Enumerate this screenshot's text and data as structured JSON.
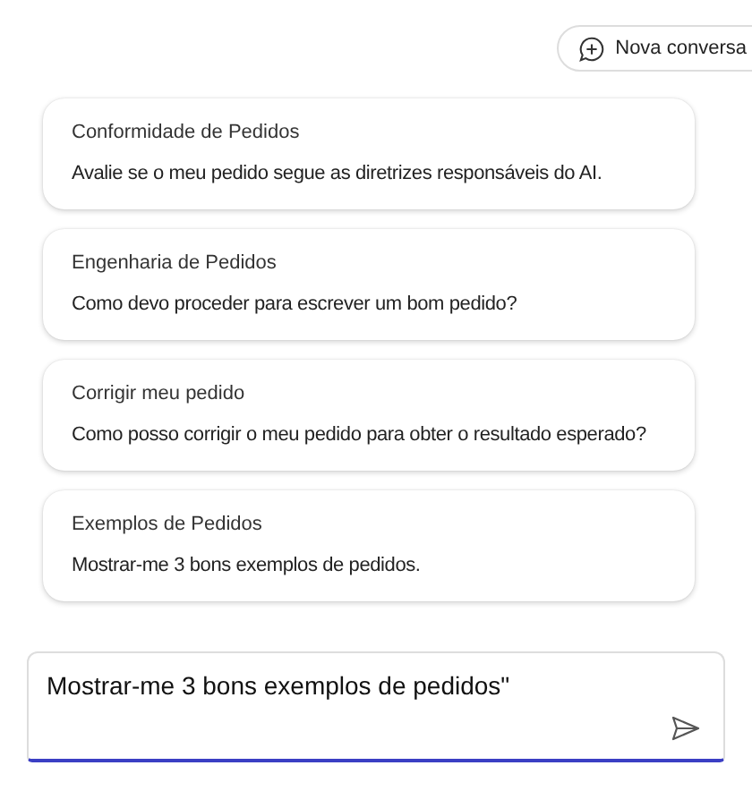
{
  "new_chat_button": {
    "label": "Nova conversa"
  },
  "suggestions": [
    {
      "title": "Conformidade de Pedidos",
      "text": "Avalie se o meu pedido segue as diretrizes responsáveis do AI."
    },
    {
      "title": "Engenharia de Pedidos",
      "text": "Como devo proceder para escrever um bom pedido?"
    },
    {
      "title": "Corrigir meu pedido",
      "text": "Como posso corrigir o meu pedido para obter o resultado esperado?"
    },
    {
      "title": "Exemplos de Pedidos",
      "text": "Mostrar-me 3 bons exemplos de pedidos."
    }
  ],
  "input": {
    "value": "Mostrar-me 3 bons exemplos de pedidos\""
  }
}
